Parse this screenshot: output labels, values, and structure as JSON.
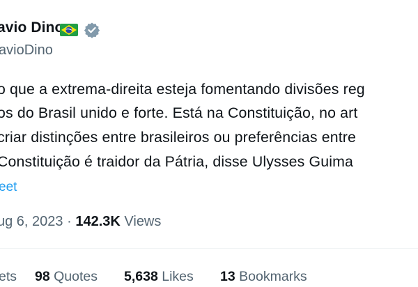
{
  "author": {
    "name": "avio Dino",
    "handle": "avioDino",
    "flag": "brazil-flag-icon",
    "verified": true
  },
  "tweet": {
    "lines": [
      "o que a extrema-direita esteja fomentando divisões reg",
      "os do Brasil unido e forte. Está na Constituição, no art",
      "criar distinções entre brasileiros ou preferências entre",
      "Constituição é traidor da Pátria, disse Ulysses Guima"
    ],
    "translate_label": "eet",
    "date": "ug 6, 2023",
    "separator": "·",
    "views_count": "142.3K",
    "views_label": "Views"
  },
  "stats": {
    "reposts_label": "ets",
    "quotes_count": "98",
    "quotes_label": "Quotes",
    "likes_count": "5,638",
    "likes_label": "Likes",
    "bookmarks_count": "13",
    "bookmarks_label": "Bookmarks"
  },
  "colors": {
    "link": "#1d9bf0",
    "muted": "#536471",
    "text": "#0f1419"
  }
}
